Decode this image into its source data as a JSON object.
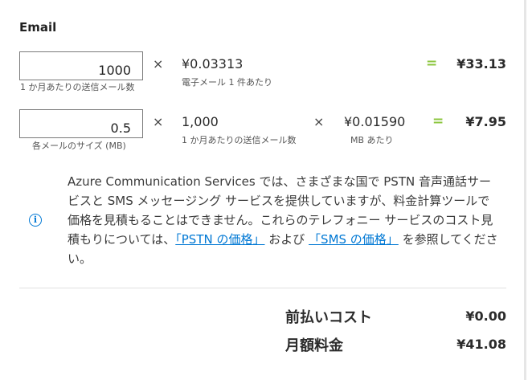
{
  "section": {
    "title": "Email"
  },
  "row1": {
    "input_value": "1000",
    "input_caption": "1 か月あたりの送信メール数",
    "times": "×",
    "rate": "¥0.03313",
    "rate_caption": "電子メール 1 件あたり",
    "equals": "=",
    "total": "¥33.13"
  },
  "row2": {
    "input_value": "0.5",
    "input_caption": "各メールのサイズ (MB)",
    "times1": "×",
    "count": "1,000",
    "count_caption": "1 か月あたりの送信メール数",
    "times2": "×",
    "rate": "¥0.01590",
    "rate_caption": "MB あたり",
    "equals": "=",
    "total": "¥7.95"
  },
  "info": {
    "text_before": "Azure Communication Services では、さまざまな国で PSTN 音声通話サービスと SMS メッセージング サービスを提供していますが、料金計算ツールで価格を見積もることはできません。これらのテレフォニー サービスのコスト見積もりについては、",
    "link1": "「PSTN の価格」",
    "text_middle": " および ",
    "link2": "「SMS の価格」",
    "text_after": " を参照してください。"
  },
  "summary": {
    "upfront_label": "前払いコスト",
    "upfront_value": "¥0.00",
    "monthly_label": "月額料金",
    "monthly_value": "¥41.08"
  },
  "colors": {
    "accent": "#0078d4",
    "equals": "#8cc63f"
  },
  "icons": {
    "info": "info-icon"
  }
}
